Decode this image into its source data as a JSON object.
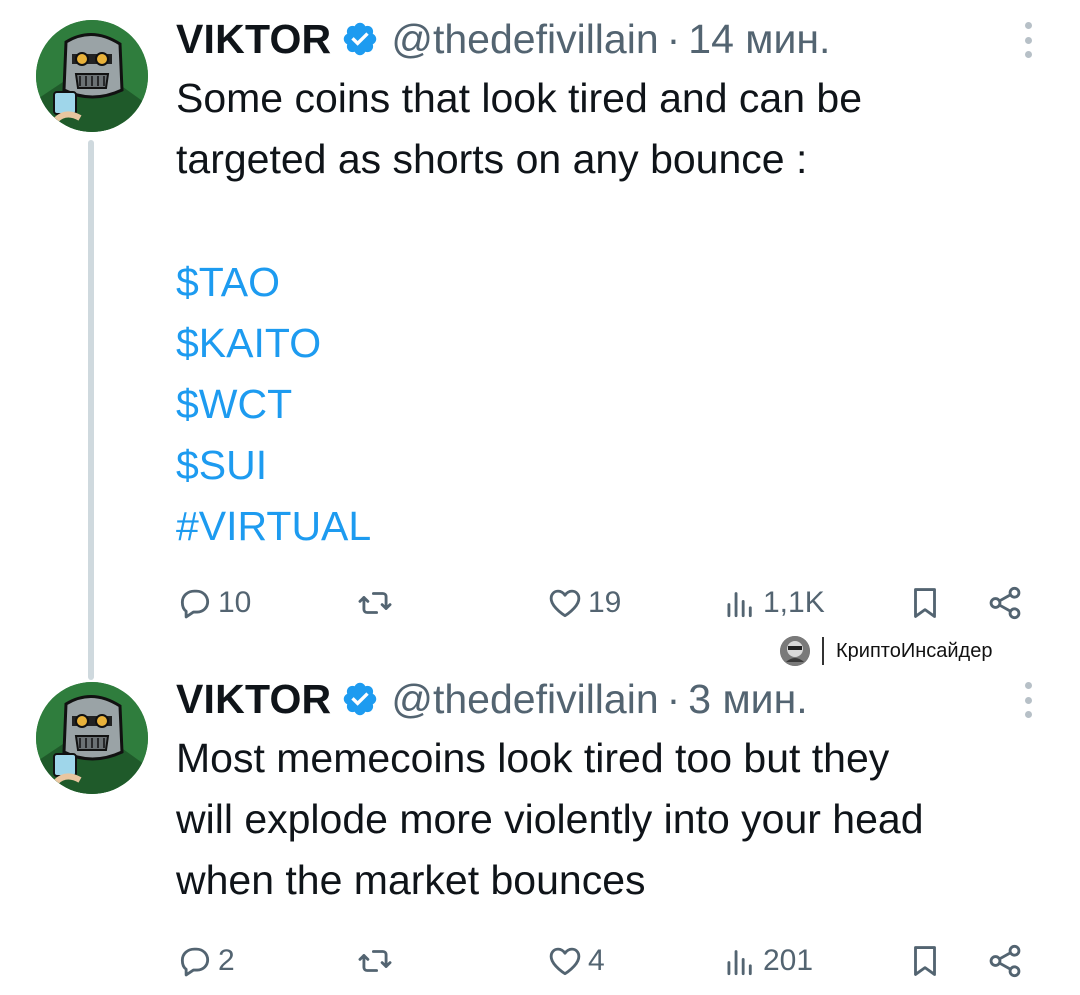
{
  "tweets": [
    {
      "author": "VIKTOR",
      "handle": "@thedefivillain",
      "separator": "·",
      "time": "14 мин.",
      "text": "Some coins that look tired and can be\ntargeted as shorts on any bounce :",
      "tickers": [
        "$TAO",
        "$KAITO",
        "$WCT",
        "$SUI",
        "#VIRTUAL"
      ],
      "stats": {
        "replies": "10",
        "retweets": "",
        "likes": "19",
        "views": "1,1K"
      }
    },
    {
      "author": "VIKTOR",
      "handle": "@thedefivillain",
      "separator": "·",
      "time": "3 мин.",
      "text": "Most memecoins look tired too but they\nwill explode more violently into your head\nwhen the market bounces",
      "stats": {
        "replies": "2",
        "retweets": "",
        "likes": "4",
        "views": "201"
      }
    }
  ],
  "watermark": {
    "text": "КриптоИнсайдер",
    "logo_icon": "masked-figure-logo"
  },
  "icons": {
    "verified": "verified-badge-icon",
    "reply": "reply-icon",
    "retweet": "retweet-icon",
    "like": "heart-icon",
    "views": "views-icon",
    "bookmark": "bookmark-icon",
    "share": "share-icon",
    "more": "more-vertical-icon"
  },
  "colors": {
    "link": "#1d9bf0",
    "verified": "#1d9bf0",
    "muted": "#536471",
    "thread_line": "#cfd9de",
    "text": "#0f1419"
  }
}
